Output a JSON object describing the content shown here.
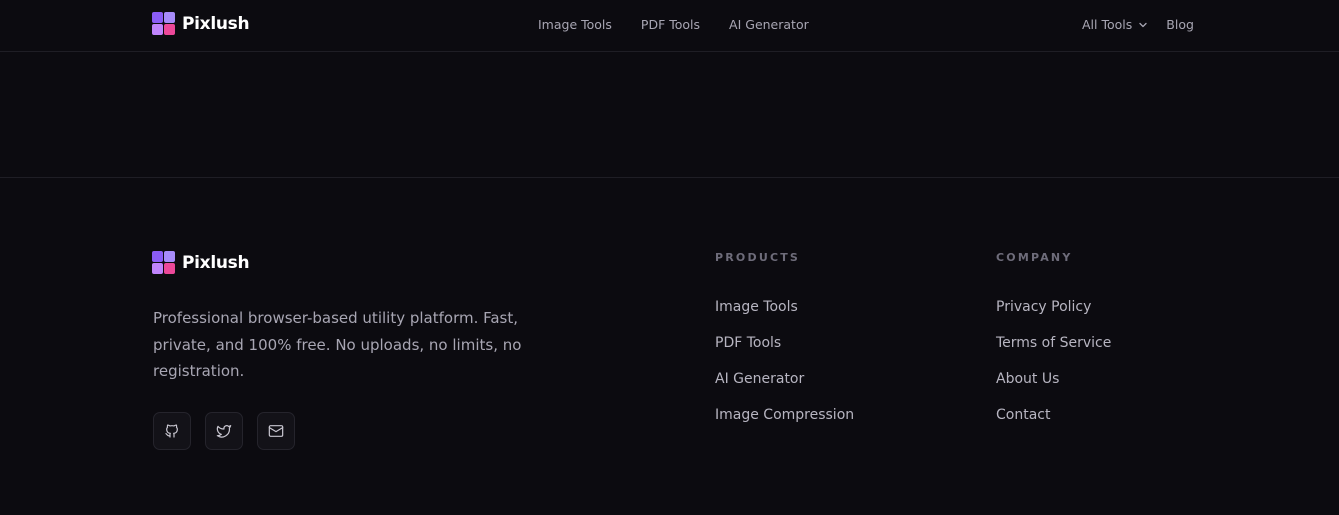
{
  "brand": {
    "name": "Pixlush"
  },
  "nav": {
    "links": [
      "Image Tools",
      "PDF Tools",
      "AI Generator"
    ],
    "all_tools": "All Tools",
    "blog": "Blog"
  },
  "footer": {
    "tagline": "Professional browser-based utility platform. Fast, private, and 100% free. No uploads, no limits, no registration.",
    "socials": [
      "github-icon",
      "twitter-icon",
      "mail-icon"
    ],
    "products": {
      "heading": "PRODUCTS",
      "items": [
        "Image Tools",
        "PDF Tools",
        "AI Generator",
        "Image Compression"
      ]
    },
    "company": {
      "heading": "COMPANY",
      "items": [
        "Privacy Policy",
        "Terms of Service",
        "About Us",
        "Contact"
      ]
    }
  },
  "colors": {
    "background": "#0c0b10",
    "logo_purple": "#8b5cf6",
    "logo_pink": "#ec4899"
  }
}
